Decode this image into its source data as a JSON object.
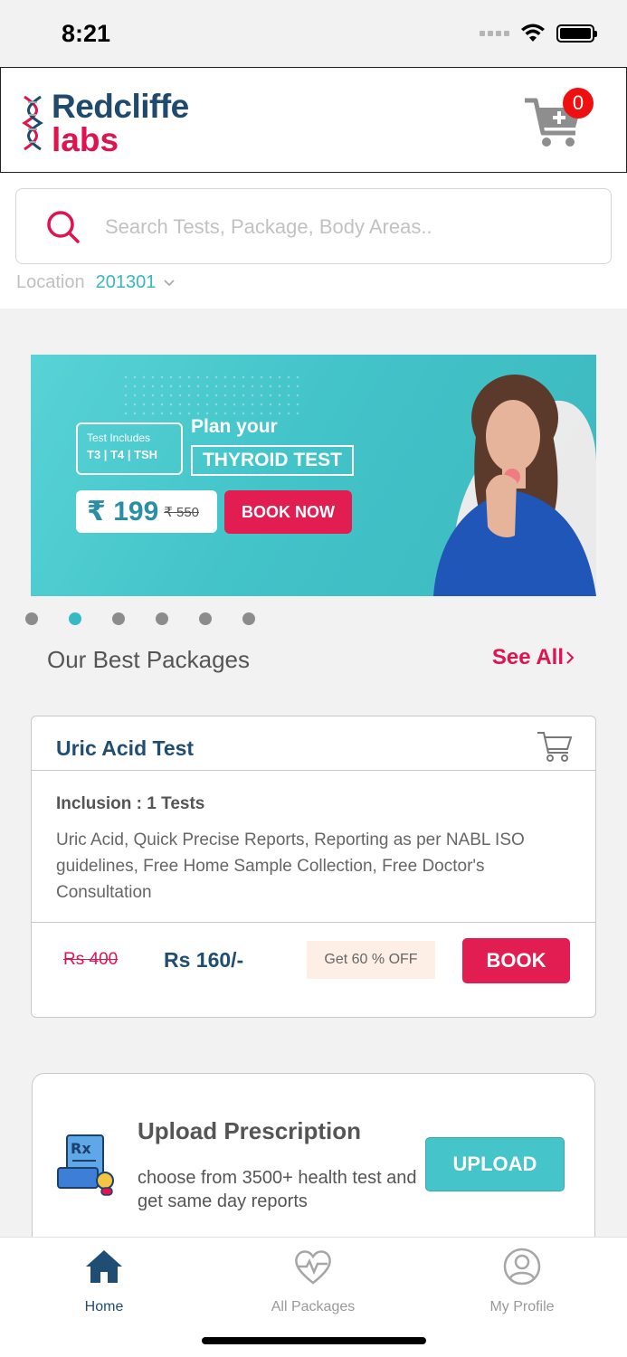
{
  "status_bar": {
    "time": "8:21"
  },
  "brand": {
    "name_line1": "Redcliffe",
    "name_line2": "labs"
  },
  "cart": {
    "count": "0"
  },
  "search": {
    "placeholder": "Search Tests, Package, Body Areas.."
  },
  "location": {
    "label": "Location",
    "value": "201301"
  },
  "banner": {
    "test_includes_label": "Test Includes",
    "test_includes_value": "T3 | T4 | TSH",
    "plan_text": "Plan your",
    "highlight": "THYROID TEST",
    "price": "₹ 199",
    "old_price": "₹ 550",
    "cta": "BOOK NOW"
  },
  "carousel": {
    "count": 6,
    "active_index": 1
  },
  "best_packages": {
    "title": "Our Best Packages",
    "see_all": "See All"
  },
  "package": {
    "title": "Uric Acid Test",
    "inclusion": "Inclusion : 1 Tests",
    "description": "Uric Acid, Quick Precise Reports, Reporting as per NABL ISO guidelines, Free Home Sample Collection, Free Doctor's Consultation",
    "old_price": "Rs 400",
    "price": "Rs 160/-",
    "offer": "Get 60 % OFF",
    "book_label": "BOOK"
  },
  "upload": {
    "title": "Upload Prescription",
    "description": "choose from 3500+ health test and get same day reports",
    "button": "UPLOAD"
  },
  "nav": {
    "items": [
      {
        "label": "Home",
        "icon": "home-icon",
        "active": true
      },
      {
        "label": "All Packages",
        "icon": "heart-pulse-icon",
        "active": false
      },
      {
        "label": "My Profile",
        "icon": "user-icon",
        "active": false
      }
    ]
  },
  "colors": {
    "brand_navy": "#1f4d74",
    "brand_red": "#e0134f",
    "teal": "#45c4c9",
    "badge_red": "#ee1010"
  }
}
